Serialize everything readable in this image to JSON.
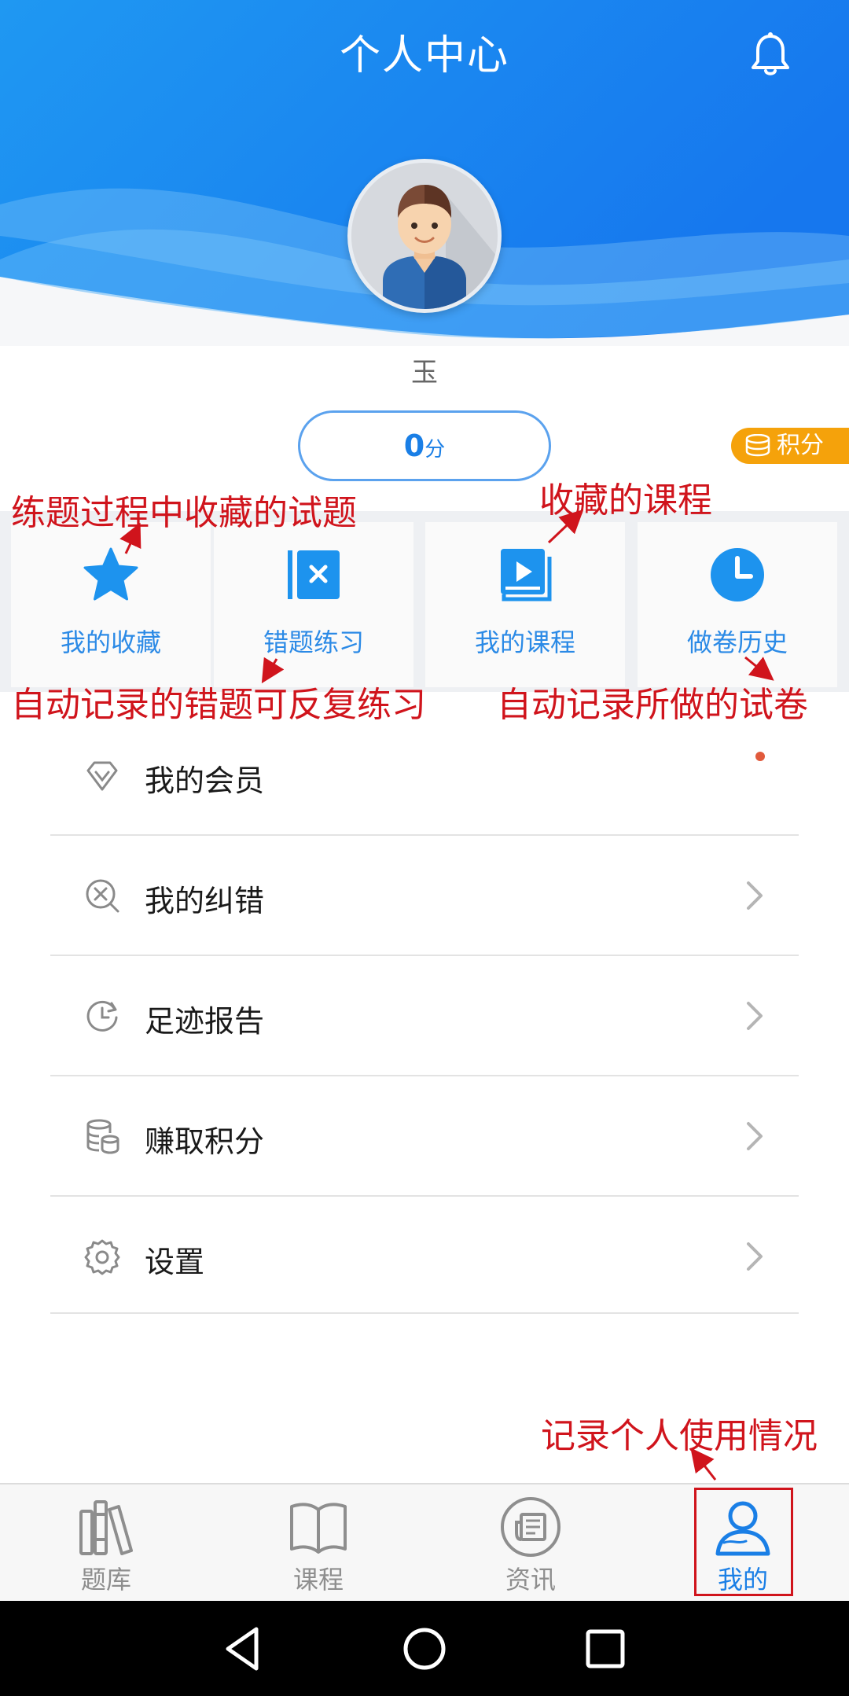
{
  "header": {
    "title": "个人中心"
  },
  "user": {
    "name": "玉",
    "points_value": "0",
    "points_unit": "分",
    "points_badge": "积分"
  },
  "tiles": [
    {
      "label": "我的收藏",
      "icon": "star-icon"
    },
    {
      "label": "错题练习",
      "icon": "wrong-questions-icon"
    },
    {
      "label": "我的课程",
      "icon": "course-book-icon"
    },
    {
      "label": "做卷历史",
      "icon": "clock-icon"
    }
  ],
  "menu": [
    {
      "label": "我的会员",
      "icon": "diamond-icon"
    },
    {
      "label": "我的纠错",
      "icon": "correction-icon"
    },
    {
      "label": "足迹报告",
      "icon": "history-icon"
    },
    {
      "label": "赚取积分",
      "icon": "coins-icon"
    },
    {
      "label": "设置",
      "icon": "gear-icon"
    }
  ],
  "annotations": {
    "favorites": "练题过程中收藏的试题",
    "courses": "收藏的课程",
    "wrong": "自动记录的错题可反复练习",
    "history": "自动记录所做的试卷",
    "mine": "记录个人使用情况"
  },
  "tabbar": [
    {
      "label": "题库",
      "icon": "books-icon",
      "active": false
    },
    {
      "label": "课程",
      "icon": "open-book-icon",
      "active": false
    },
    {
      "label": "资讯",
      "icon": "news-icon",
      "active": false
    },
    {
      "label": "我的",
      "icon": "user-icon",
      "active": true
    }
  ],
  "colors": {
    "primary": "#1a7fe6",
    "annotation": "#d0141c",
    "badge": "#f5a20b"
  }
}
